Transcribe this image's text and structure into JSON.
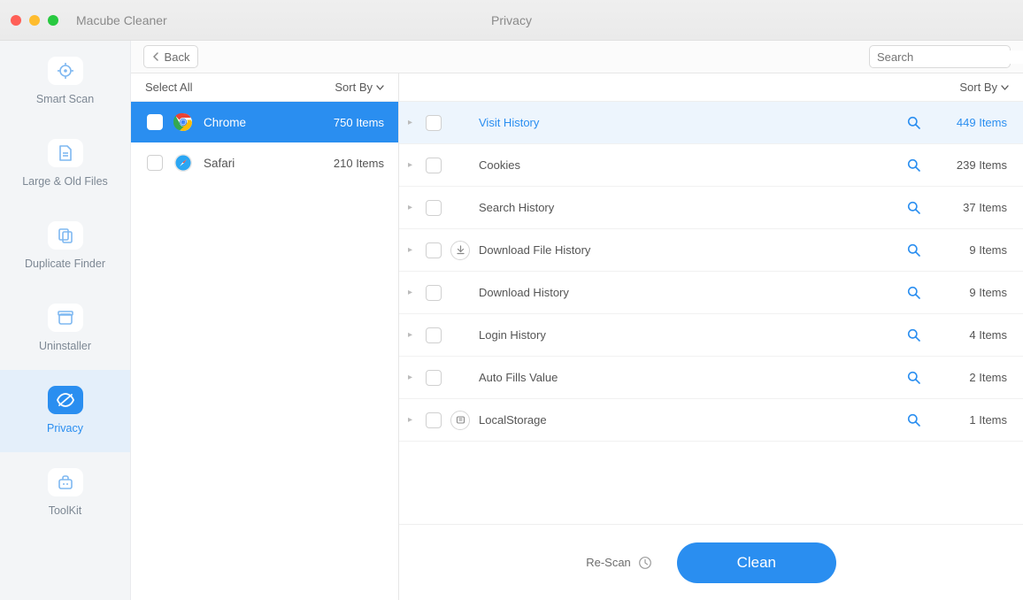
{
  "app": {
    "title": "Macube Cleaner",
    "page_title": "Privacy"
  },
  "toolbar": {
    "back_label": "Back",
    "search_placeholder": "Search"
  },
  "sidebar": {
    "items": [
      {
        "label": "Smart Scan",
        "icon": "target-icon",
        "active": false
      },
      {
        "label": "Large & Old Files",
        "icon": "file-icon",
        "active": false
      },
      {
        "label": "Duplicate Finder",
        "icon": "copy-icon",
        "active": false
      },
      {
        "label": "Uninstaller",
        "icon": "box-icon",
        "active": false
      },
      {
        "label": "Privacy",
        "icon": "eye-off-icon",
        "active": true
      },
      {
        "label": "ToolKit",
        "icon": "toolbox-icon",
        "active": false
      }
    ]
  },
  "left": {
    "select_all": "Select All",
    "sort_by": "Sort By",
    "browsers": [
      {
        "name": "Chrome",
        "count": "750 Items",
        "selected": true,
        "icon": "chrome-icon"
      },
      {
        "name": "Safari",
        "count": "210 Items",
        "selected": false,
        "icon": "safari-icon"
      }
    ]
  },
  "right": {
    "sort_by": "Sort By",
    "categories": [
      {
        "name": "Visit History",
        "count": "449 Items",
        "selected": true,
        "extra_icon": null
      },
      {
        "name": "Cookies",
        "count": "239 Items",
        "selected": false,
        "extra_icon": null
      },
      {
        "name": "Search History",
        "count": "37 Items",
        "selected": false,
        "extra_icon": null
      },
      {
        "name": "Download File History",
        "count": "9 Items",
        "selected": false,
        "extra_icon": "download-circle-icon"
      },
      {
        "name": "Download History",
        "count": "9 Items",
        "selected": false,
        "extra_icon": null
      },
      {
        "name": "Login History",
        "count": "4 Items",
        "selected": false,
        "extra_icon": null
      },
      {
        "name": "Auto Fills Value",
        "count": "2 Items",
        "selected": false,
        "extra_icon": null
      },
      {
        "name": "LocalStorage",
        "count": "1 Items",
        "selected": false,
        "extra_icon": "storage-circle-icon"
      }
    ]
  },
  "footer": {
    "rescan": "Re-Scan",
    "clean": "Clean"
  }
}
